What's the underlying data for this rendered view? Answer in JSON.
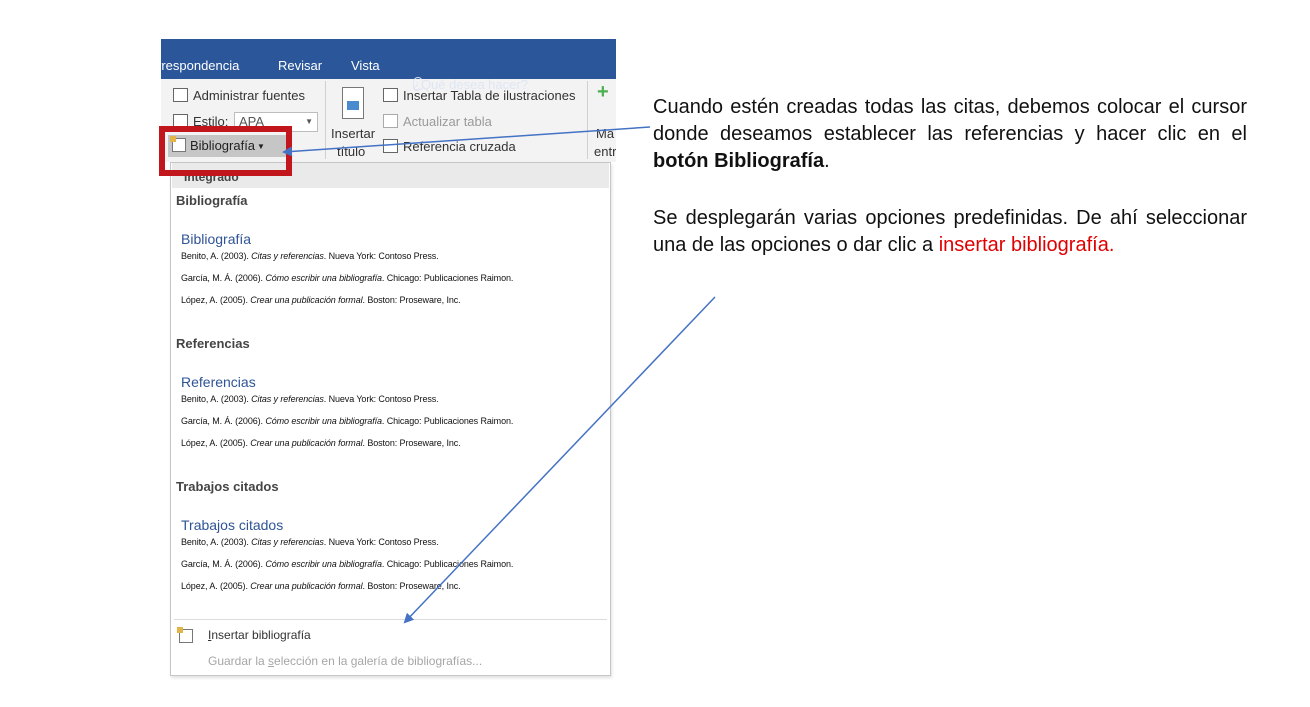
{
  "ribbon": {
    "tabs": [
      "rrespondencia",
      "Revisar",
      "Vista"
    ],
    "tell_me": "¿Qué desea hacer?",
    "manage_sources": "Administrar fuentes",
    "style_label": "Estilo:",
    "style_value": "APA",
    "bibliography_button": "Bibliografía",
    "insert_caption_line1": "Insertar",
    "insert_caption_line2": "título",
    "insert_table_figures": "Insertar Tabla de ilustraciones",
    "update_table": "Actualizar tabla",
    "cross_reference": "Referencia cruzada",
    "mark_entry_line1": "Ma",
    "mark_entry_line2": "entr"
  },
  "dropdown": {
    "integrated_header": "Integrado",
    "sections": [
      {
        "header": "Bibliografía",
        "title": "Bibliografía",
        "refs": [
          {
            "pre": "Benito, A. (2003). ",
            "ital": "Citas y referencias",
            "post": ". Nueva York: Contoso Press."
          },
          {
            "pre": "García, M. Á. (2006). ",
            "ital": "Cómo escribir una bibliografía",
            "post": ". Chicago: Publicaciones Raimon."
          },
          {
            "pre": "López, A. (2005). ",
            "ital": "Crear una publicación formal",
            "post": ". Boston: Proseware, Inc."
          }
        ]
      },
      {
        "header": "Referencias",
        "title": "Referencias",
        "refs": [
          {
            "pre": "Benito, A. (2003). ",
            "ital": "Citas y referencias",
            "post": ". Nueva York: Contoso Press."
          },
          {
            "pre": "García, M. Á. (2006). ",
            "ital": "Cómo escribir una bibliografía",
            "post": ". Chicago: Publicaciones Raimon."
          },
          {
            "pre": "López, A. (2005). ",
            "ital": "Crear una publicación formal",
            "post": ". Boston: Proseware, Inc."
          }
        ]
      },
      {
        "header": "Trabajos citados",
        "title": "Trabajos citados",
        "refs": [
          {
            "pre": "Benito, A. (2003). ",
            "ital": "Citas y referencias",
            "post": ". Nueva York: Contoso Press."
          },
          {
            "pre": "García, M. Á. (2006). ",
            "ital": "Cómo escribir una bibliografía",
            "post": ". Chicago: Publicaciones Raimon."
          },
          {
            "pre": "López, A. (2005). ",
            "ital": "Crear una publicación formal",
            "post": ". Boston: Proseware, Inc."
          }
        ]
      }
    ],
    "insert_first": "I",
    "insert_rest": "nsertar bibliografía",
    "save_pre": "Guardar la ",
    "save_u": "s",
    "save_post": "elección en la galería de bibliografías..."
  },
  "notes": {
    "p1_text": "Cuando estén creadas todas las citas, debemos colocar el cursor donde deseamos establecer las referencias y hacer clic en el ",
    "p1_bold": "botón Bibliografía",
    "p1_end": ".",
    "p2_text": "Se desplegarán varias opciones predefinidas. De ahí seleccionar una de las opciones o dar clic a ",
    "p2_red": "insertar bibliografía."
  },
  "colors": {
    "ribbon_blue": "#2b579a",
    "highlight_red": "#c0161c",
    "arrow_blue": "#4472c4",
    "accent_red_text": "#e00000",
    "section_title_blue": "#2f5496"
  }
}
